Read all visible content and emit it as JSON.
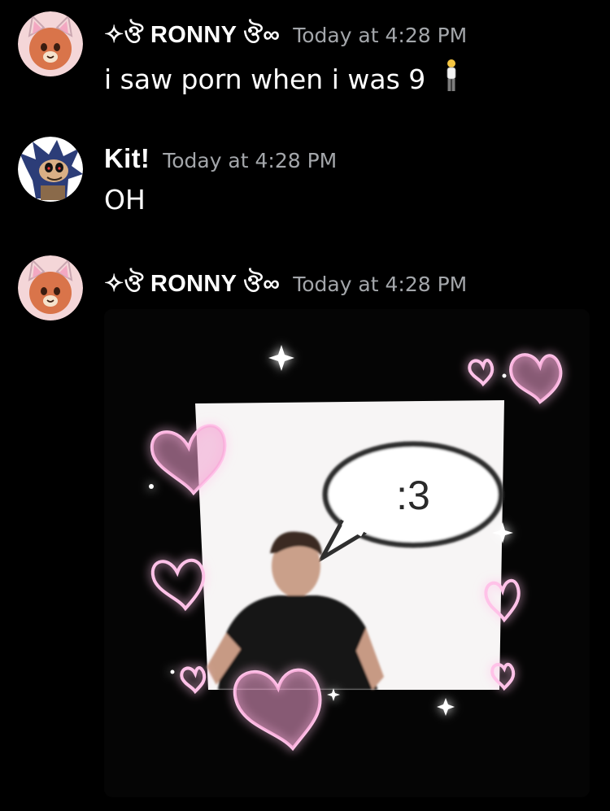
{
  "messages": [
    {
      "username": "✧ ঔৣ RONNY ঔৣ ∞",
      "username_display": "✧ঔ RONNY ঔ∞",
      "timestamp": "Today at 4:28 PM",
      "text": "i saw porn when i was 9",
      "emoji": "person-standing-emoji"
    },
    {
      "username": "Kit!",
      "timestamp": "Today at 4:28 PM",
      "text": "OH"
    },
    {
      "username": "✧ ঔৣ RONNY ঔৣ ∞",
      "username_display": "✧ঔ RONNY ঔ∞",
      "timestamp": "Today at 4:28 PM",
      "attachment": {
        "type": "image",
        "speech_bubble_text": ":3"
      }
    }
  ],
  "colors": {
    "background": "#000000",
    "username": "#ffffff",
    "timestamp": "#a3a6aa",
    "heart": "#f7a8d6"
  }
}
